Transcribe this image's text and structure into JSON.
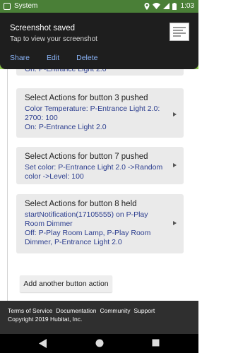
{
  "status_bar": {
    "app_name": "System",
    "time": "1:03",
    "icons": [
      "screenshot-icon",
      "location-icon",
      "wifi-icon",
      "cell-signal-icon",
      "battery-icon"
    ]
  },
  "notification": {
    "title": "Screenshot saved",
    "subtitle": "Tap to view your screenshot",
    "actions": [
      "Share",
      "Edit",
      "Delete"
    ]
  },
  "partial_card": {
    "text": "On: P-Entrance Light 2.0"
  },
  "cards": [
    {
      "title": "Select Actions for button 3 pushed",
      "lines": [
        "Color Temperature: P-Entrance Light 2.0:",
        "2700: 100",
        "On: P-Entrance Light 2.0"
      ]
    },
    {
      "title": "Select Actions for button 7 pushed",
      "lines": [
        "Set color: P-Entrance Light 2.0 ->Random",
        "color  ->Level: 100"
      ]
    },
    {
      "title": "Select Actions for button 8 held",
      "lines": [
        "startNotification(17105555) on P-Play",
        "Room Dimmer",
        "Off: P-Play Room Lamp, P-Play Room",
        "Dimmer, P-Entrance Light 2.0"
      ]
    }
  ],
  "add_button_label": "Add another button action",
  "footer": {
    "links": [
      "Terms of Service",
      "Documentation",
      "Community",
      "Support"
    ],
    "copyright": "Copyright 2019 Hubitat, Inc."
  },
  "colors": {
    "status_bar": "#4a7f37",
    "header": "#8bc34a",
    "card_bg": "#eaeaea",
    "card_link_text": "#2c3e8f",
    "notification_bg": "#1e1e1e",
    "notification_action": "#8ab4f8",
    "footer_bg": "#2f2f2f"
  }
}
